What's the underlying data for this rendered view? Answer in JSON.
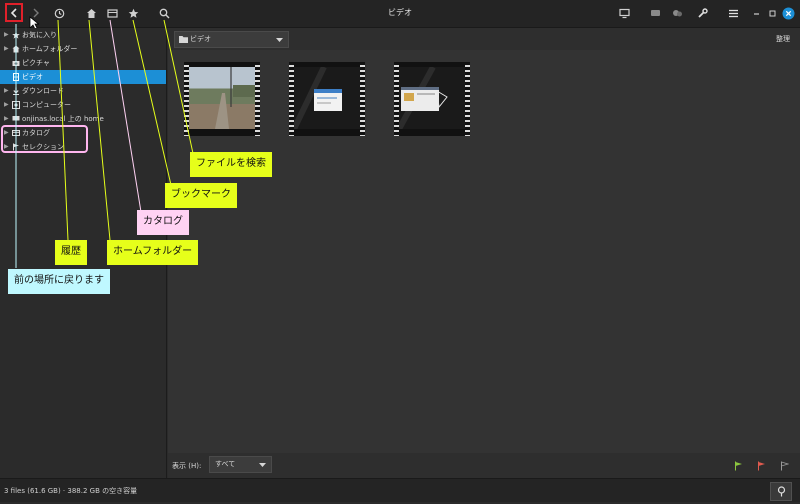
{
  "header": {
    "title": "ビデオ",
    "left_icons": [
      "back-icon",
      "forward-icon",
      "history-icon",
      "home-icon",
      "catalog-icon",
      "bookmark-icon",
      "search-icon"
    ],
    "right_icons": [
      "monitor-icon",
      "chat-icon",
      "tag-icon",
      "wrench-icon",
      "menu-icon",
      "minimize-icon",
      "maximize-icon",
      "close-icon"
    ]
  },
  "sidebar": {
    "items": [
      {
        "label": "お気に入り",
        "icon": "star-icon",
        "expandable": true
      },
      {
        "label": "ホームフォルダー",
        "icon": "home-icon",
        "expandable": true
      },
      {
        "label": "ピクチャ",
        "icon": "camera-icon",
        "expandable": false
      },
      {
        "label": "ビデオ",
        "icon": "film-icon",
        "expandable": false,
        "selected": true
      },
      {
        "label": "ダウンロード",
        "icon": "download-icon",
        "expandable": true
      },
      {
        "label": "コンピューター",
        "icon": "computer-icon",
        "expandable": true
      },
      {
        "label": "onjinas.local 上の home",
        "icon": "network-icon",
        "expandable": true
      },
      {
        "label": "カタログ",
        "icon": "catalog-icon",
        "expandable": true
      },
      {
        "label": "セレクション",
        "icon": "flag-icon",
        "expandable": true
      }
    ]
  },
  "main": {
    "path_select": "ビデオ",
    "sort_label": "整理",
    "show_label": "表示 (H):",
    "show_value": "すべて"
  },
  "status": {
    "text": "3 files (61.6 GB)  ·  388.2 GB の空き容量"
  },
  "callouts": {
    "search": "ファイルを検索",
    "bookmark": "ブックマーク",
    "catalog": "カタログ",
    "history": "履歴",
    "home": "ホームフォルダー",
    "back": "前の場所に戻ります"
  },
  "colors": {
    "selected": "#1c8fd6",
    "callout_yellow": "#e6ff1a",
    "callout_pink": "#ffd2f3",
    "callout_cyan": "#bff8ff",
    "back_highlight": "#e0202a"
  }
}
